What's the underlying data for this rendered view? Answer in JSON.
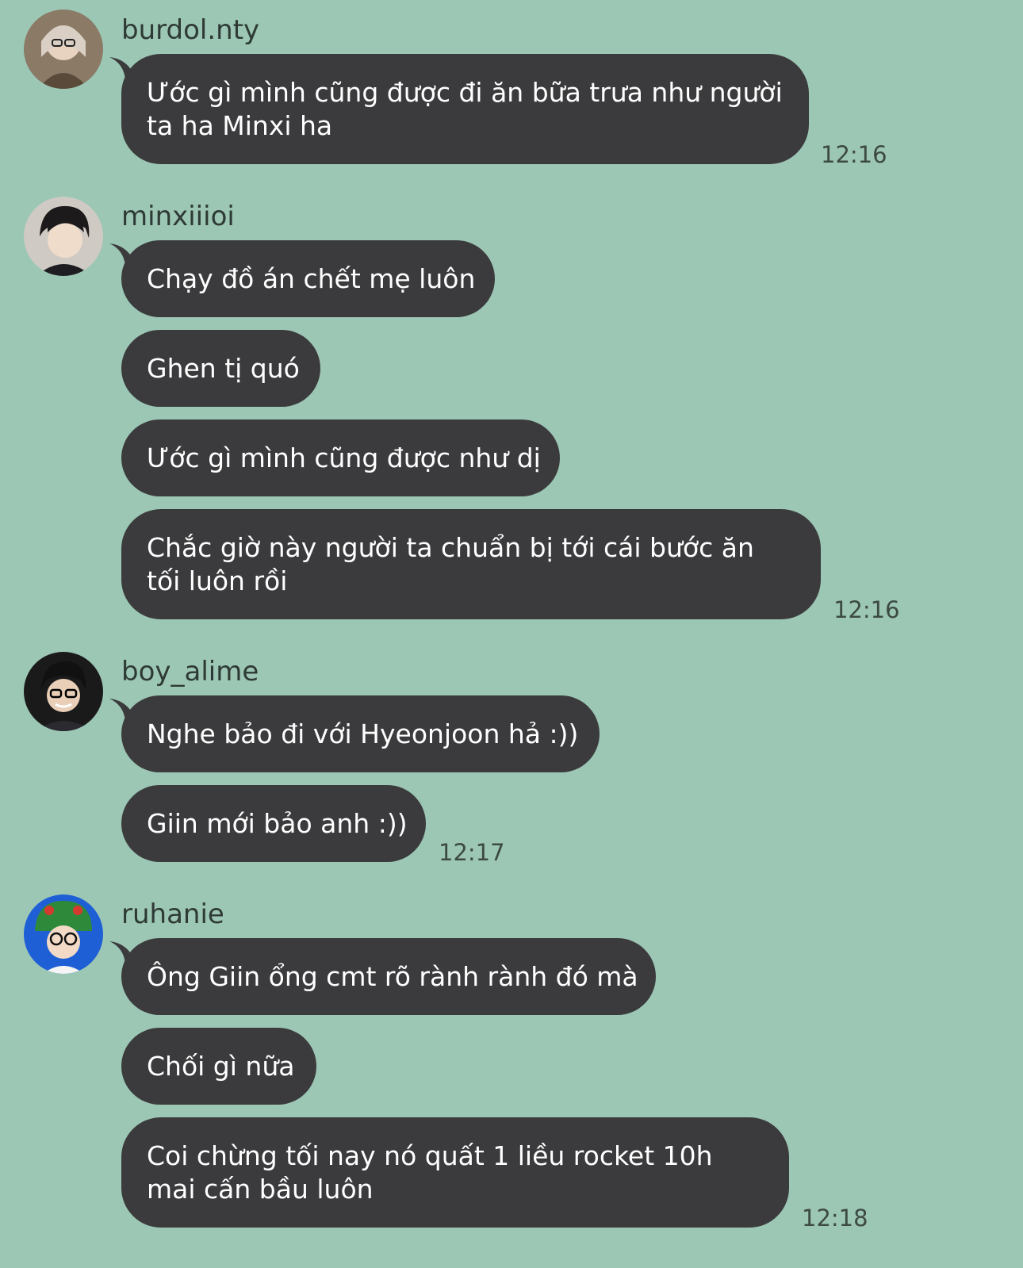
{
  "colors": {
    "background": "#9dc7b5",
    "bubble": "#3b3b3d",
    "bubble_text": "#ffffff"
  },
  "groups": [
    {
      "username": "burdol.nty",
      "avatar_icon": "avatar-burdol-icon",
      "messages": [
        "Ước gì mình cũng được đi ăn bữa trưa như người ta ha Minxi ha"
      ],
      "time": "12:16"
    },
    {
      "username": "minxiiioi",
      "avatar_icon": "avatar-minxi-icon",
      "messages": [
        "Chạy đồ án chết mẹ luôn",
        "Ghen tị quó",
        "Ước gì mình cũng được như dị",
        "Chắc giờ này người ta chuẩn bị tới cái bước ăn tối luôn rồi"
      ],
      "time": "12:16"
    },
    {
      "username": "boy_alime",
      "avatar_icon": "avatar-boy-alime-icon",
      "messages": [
        "Nghe bảo đi với Hyeonjoon hả :))",
        "Giin mới bảo anh :))"
      ],
      "time": "12:17"
    },
    {
      "username": "ruhanie",
      "avatar_icon": "avatar-ruhanie-icon",
      "messages": [
        "Ông Giin ổng cmt rõ rành rành đó mà",
        "Chối gì nữa",
        "Coi chừng tối nay nó quất 1 liều rocket 10h mai cấn bầu luôn"
      ],
      "time": "12:18"
    }
  ]
}
